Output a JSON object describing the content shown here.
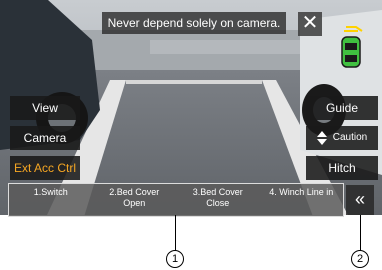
{
  "warning": {
    "text": "Never depend solely on camera."
  },
  "close_glyph": "✕",
  "left_buttons": {
    "view": "View",
    "camera": "Camera",
    "ext_acc": "Ext Acc Ctrl"
  },
  "right_buttons": {
    "guide": "Guide",
    "caution": "Caution",
    "hitch": "Hitch"
  },
  "aux_buttons": [
    {
      "line1": "1.Switch",
      "line2": ""
    },
    {
      "line1": "2.Bed Cover",
      "line2": "Open"
    },
    {
      "line1": "3.Bed Cover",
      "line2": "Close"
    },
    {
      "line1": "4. Winch Line in",
      "line2": ""
    }
  ],
  "collapse_glyph": "«",
  "callouts": {
    "one": "1",
    "two": "2"
  },
  "colors": {
    "ext_acc_text": "#f5a623",
    "sensor_yellow": "#ffd200",
    "sensor_green": "#40c040"
  }
}
